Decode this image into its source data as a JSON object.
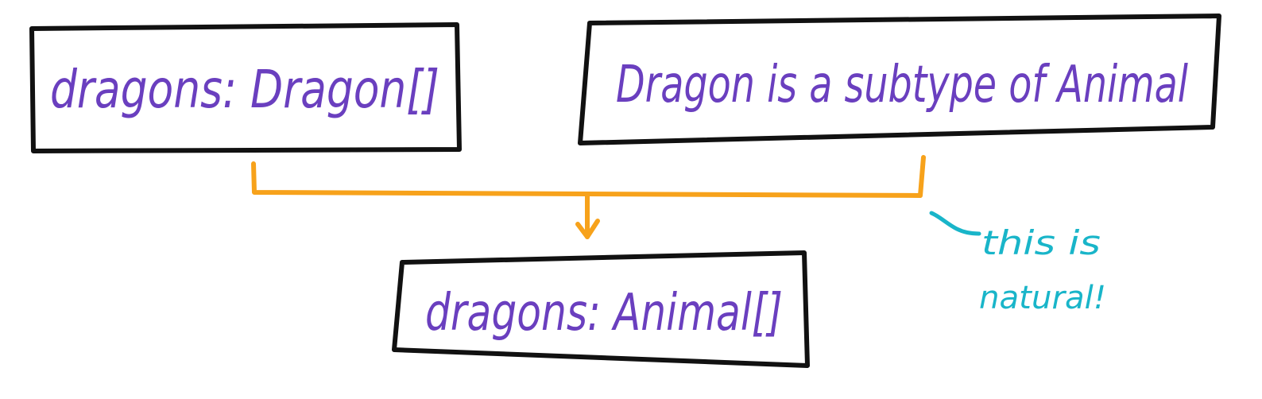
{
  "colors": {
    "ink": "#111111",
    "text": "#6a3fbf",
    "connector": "#f7a21b",
    "note": "#19b5c9"
  },
  "boxes": {
    "dragons_dragon": {
      "text": "dragons: Dragon[]"
    },
    "subtype_statement": {
      "text": "Dragon is a subtype of Animal"
    },
    "dragons_animal": {
      "text": "dragons: Animal[]"
    }
  },
  "annotation": {
    "line1": "this is",
    "line2": "natural!"
  }
}
